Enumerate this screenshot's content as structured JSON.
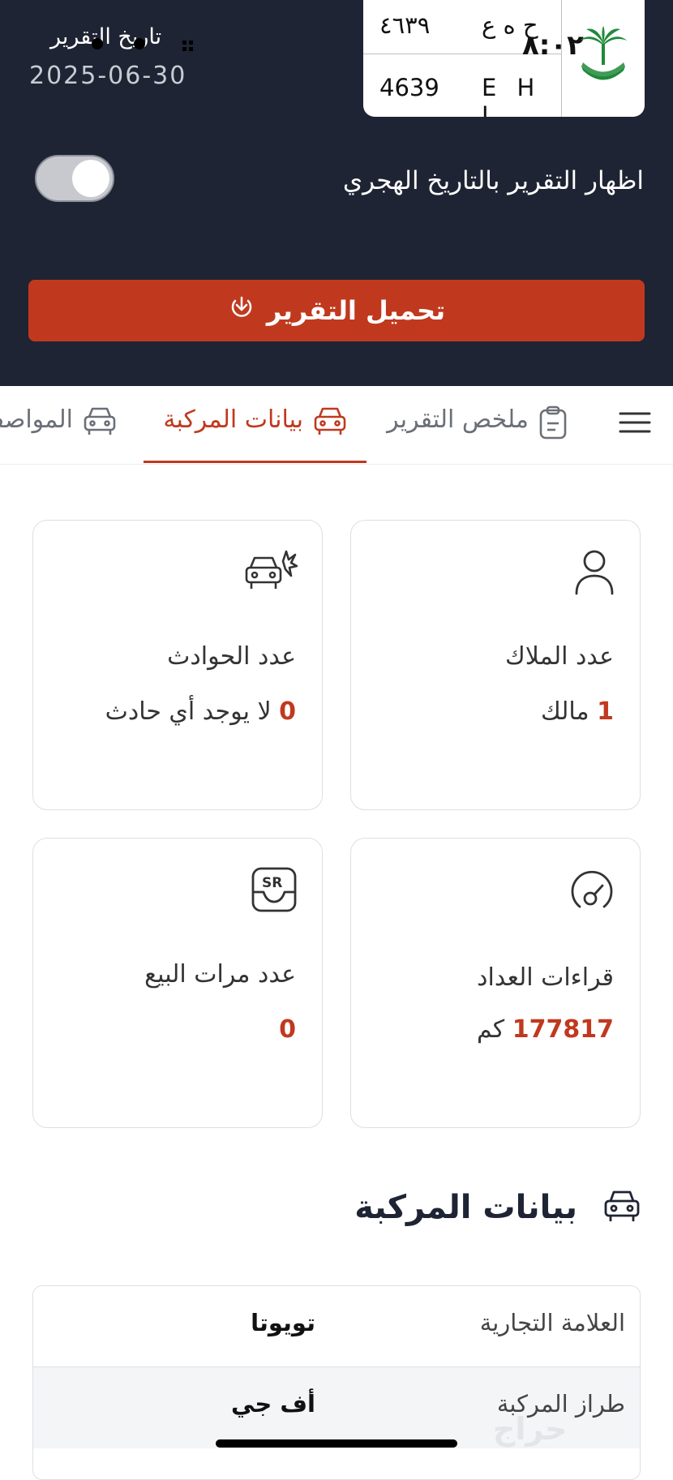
{
  "header": {
    "status_time": "٨:٠٢",
    "report_date_label": "تاريخ التقرير",
    "report_date": "2025-06-30",
    "plate": {
      "arabic_numbers": "٤٦٣٩",
      "arabic_letters": "ح ه ع",
      "latin_numbers": "4639",
      "latin_letters": "E H J"
    },
    "hijri_toggle_label": "اظهار التقرير بالتاريخ الهجري",
    "download_label": "تحميل التقرير",
    "accent_color": "#c0391f",
    "background_color": "#1e2433"
  },
  "tabs": [
    {
      "label": "ملخص التقرير",
      "icon": "clipboard-icon"
    },
    {
      "label": "بيانات المركبة",
      "icon": "car-icon",
      "active": true
    },
    {
      "label": "المواصفات",
      "icon": "car-icon"
    }
  ],
  "cards": {
    "owners": {
      "title": "عدد الملاك",
      "value": "1",
      "unit": "مالك",
      "icon": "person-icon"
    },
    "accidents": {
      "title": "عدد الحوادث",
      "value": "0",
      "unit": "لا يوجد أي حادث",
      "icon": "car-crash-icon"
    },
    "odometer": {
      "title": "قراءات العداد",
      "value": "177817",
      "unit": "كم",
      "icon": "odometer-icon"
    },
    "sales": {
      "title": "عدد مرات البيع",
      "value": "0",
      "icon": "sale-sr-icon"
    }
  },
  "vehicle_section": {
    "title": "بيانات المركبة",
    "rows": [
      {
        "label": "العلامة التجارية",
        "value": "تويوتا"
      },
      {
        "label": "طراز المركبة",
        "value": "أف جي"
      }
    ]
  },
  "watermark": "حراج"
}
